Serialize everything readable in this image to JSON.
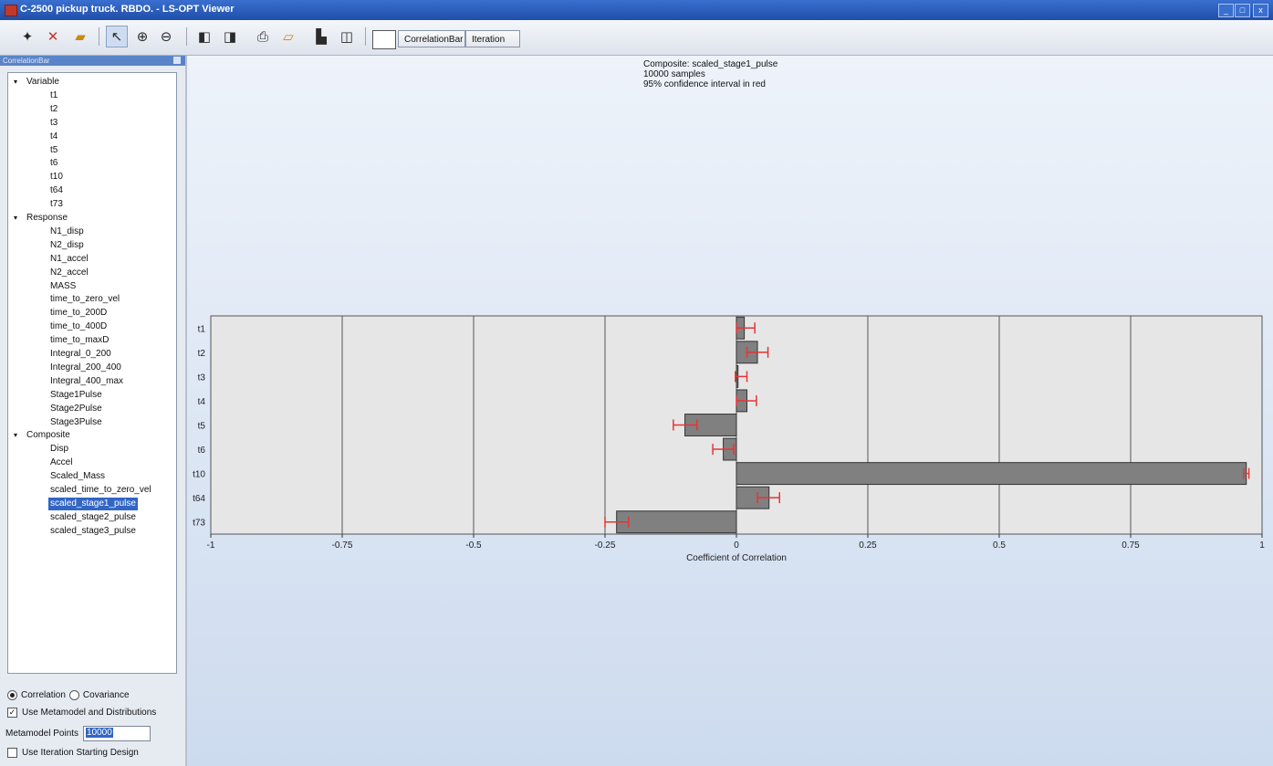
{
  "window": {
    "title": "C-2500 pickup truck. RBDO. - LS-OPT Viewer",
    "controls": [
      "_",
      "□",
      "x"
    ]
  },
  "toolbar": {
    "icons": [
      "add-plot-icon",
      "delete-plot-icon",
      "open-icon",
      "pointer-icon",
      "zoom-in-icon",
      "zoom-out-icon",
      "prev-icon",
      "next-icon",
      "print-icon",
      "export-icon",
      "layout-icon",
      "columns-icon"
    ],
    "tab_correlation": "CorrelationBar",
    "tab_iteration": "Iteration"
  },
  "sidebar": {
    "header": "CorrelationBar",
    "groups": [
      {
        "label": "Variable",
        "items": [
          "t1",
          "t2",
          "t3",
          "t4",
          "t5",
          "t6",
          "t10",
          "t64",
          "t73"
        ]
      },
      {
        "label": "Response",
        "items": [
          "N1_disp",
          "N2_disp",
          "N1_accel",
          "N2_accel",
          "MASS",
          "time_to_zero_vel",
          "time_to_200D",
          "time_to_400D",
          "time_to_maxD",
          "Integral_0_200",
          "Integral_200_400",
          "Integral_400_max",
          "Stage1Pulse",
          "Stage2Pulse",
          "Stage3Pulse"
        ]
      },
      {
        "label": "Composite",
        "items": [
          "Disp",
          "Accel",
          "Scaled_Mass",
          "scaled_time_to_zero_vel",
          "scaled_stage1_pulse",
          "scaled_stage2_pulse",
          "scaled_stage3_pulse"
        ]
      }
    ],
    "selected": "scaled_stage1_pulse",
    "radio_correlation": "Correlation",
    "radio_covariance": "Covariance",
    "selected_mode": "Correlation",
    "use_metamodel_label": "Use Metamodel and Distributions",
    "use_metamodel_checked": true,
    "metamodel_points_label": "Metamodel Points",
    "metamodel_points_value": "10000",
    "use_iteration_label": "Use Iteration Starting Design",
    "use_iteration_checked": false
  },
  "plot": {
    "heading_line1": "Composite: scaled_stage1_pulse",
    "heading_line2": "10000 samples",
    "heading_line3": "95% confidence interval in red"
  },
  "chart_data": {
    "type": "bar",
    "orientation": "horizontal",
    "categories": [
      "t1",
      "t2",
      "t3",
      "t4",
      "t5",
      "t6",
      "t10",
      "t64",
      "t73"
    ],
    "values": [
      0.015,
      0.04,
      0.003,
      0.02,
      -0.098,
      -0.025,
      0.97,
      0.062,
      -0.228
    ],
    "ci_low": [
      0.0,
      0.02,
      -0.002,
      0.0,
      -0.12,
      -0.045,
      0.965,
      0.04,
      -0.25
    ],
    "ci_high": [
      0.035,
      0.06,
      0.02,
      0.038,
      -0.075,
      -0.005,
      0.975,
      0.082,
      -0.205
    ],
    "xlabel": "Coefficient of Correlation",
    "xlim": [
      -1,
      1
    ],
    "xticks": [
      "-1",
      "-0.75",
      "-0.5",
      "-0.25",
      "0",
      "0.25",
      "0.5",
      "0.75",
      "1"
    ],
    "grid": true,
    "bar_color": "#808080",
    "ci_color": "#e53535",
    "plot_bg": "#e6e6e6"
  }
}
